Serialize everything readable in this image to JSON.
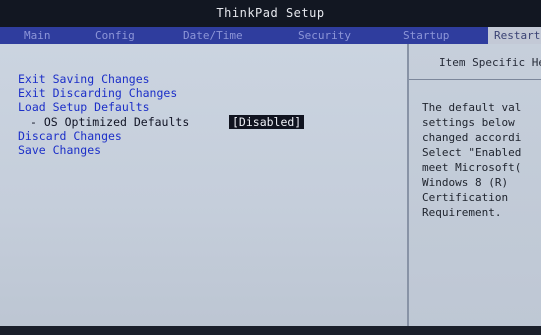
{
  "app": {
    "title": "ThinkPad Setup"
  },
  "menu": {
    "tabs": [
      {
        "label": "Main"
      },
      {
        "label": "Config"
      },
      {
        "label": "Date/Time"
      },
      {
        "label": "Security"
      },
      {
        "label": "Startup"
      },
      {
        "label": "Restart"
      }
    ],
    "active_tab": "Restart"
  },
  "main": {
    "items": [
      {
        "label": "Exit Saving Changes"
      },
      {
        "label": "Exit Discarding Changes"
      },
      {
        "label": "Load Setup Defaults"
      },
      {
        "label": "- OS Optimized Defaults",
        "value": "[Disabled]"
      },
      {
        "label": "Discard Changes"
      },
      {
        "label": "Save Changes"
      }
    ]
  },
  "help": {
    "title": "Item Specific Help",
    "text_lines": [
      "The default val",
      "settings below",
      "changed accordi",
      "Select \"Enabled",
      "meet Microsoft(",
      "Windows 8 (R)",
      "Certification",
      "Requirement."
    ]
  },
  "colors": {
    "title_bar": "#121722",
    "menu_bar": "#2f3d9e",
    "panel": "#c5cedb",
    "item_text": "#1c2fc8",
    "value_highlight": "#10131f"
  }
}
